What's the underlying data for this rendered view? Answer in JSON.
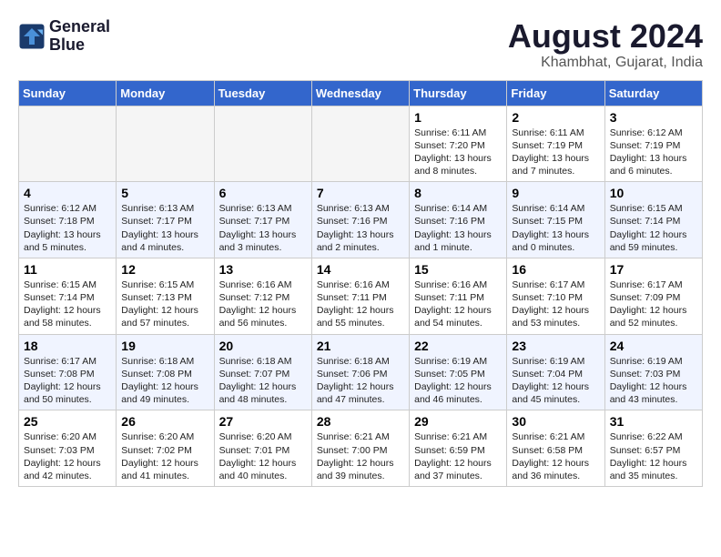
{
  "header": {
    "logo_line1": "General",
    "logo_line2": "Blue",
    "title": "August 2024",
    "subtitle": "Khambhat, Gujarat, India"
  },
  "columns": [
    "Sunday",
    "Monday",
    "Tuesday",
    "Wednesday",
    "Thursday",
    "Friday",
    "Saturday"
  ],
  "weeks": [
    {
      "days": [
        {
          "num": "",
          "empty": true
        },
        {
          "num": "",
          "empty": true
        },
        {
          "num": "",
          "empty": true
        },
        {
          "num": "",
          "empty": true
        },
        {
          "num": "1",
          "info": "Sunrise: 6:11 AM\nSunset: 7:20 PM\nDaylight: 13 hours\nand 8 minutes."
        },
        {
          "num": "2",
          "info": "Sunrise: 6:11 AM\nSunset: 7:19 PM\nDaylight: 13 hours\nand 7 minutes."
        },
        {
          "num": "3",
          "info": "Sunrise: 6:12 AM\nSunset: 7:19 PM\nDaylight: 13 hours\nand 6 minutes."
        }
      ]
    },
    {
      "days": [
        {
          "num": "4",
          "info": "Sunrise: 6:12 AM\nSunset: 7:18 PM\nDaylight: 13 hours\nand 5 minutes."
        },
        {
          "num": "5",
          "info": "Sunrise: 6:13 AM\nSunset: 7:17 PM\nDaylight: 13 hours\nand 4 minutes."
        },
        {
          "num": "6",
          "info": "Sunrise: 6:13 AM\nSunset: 7:17 PM\nDaylight: 13 hours\nand 3 minutes."
        },
        {
          "num": "7",
          "info": "Sunrise: 6:13 AM\nSunset: 7:16 PM\nDaylight: 13 hours\nand 2 minutes."
        },
        {
          "num": "8",
          "info": "Sunrise: 6:14 AM\nSunset: 7:16 PM\nDaylight: 13 hours\nand 1 minute."
        },
        {
          "num": "9",
          "info": "Sunrise: 6:14 AM\nSunset: 7:15 PM\nDaylight: 13 hours\nand 0 minutes."
        },
        {
          "num": "10",
          "info": "Sunrise: 6:15 AM\nSunset: 7:14 PM\nDaylight: 12 hours\nand 59 minutes."
        }
      ]
    },
    {
      "days": [
        {
          "num": "11",
          "info": "Sunrise: 6:15 AM\nSunset: 7:14 PM\nDaylight: 12 hours\nand 58 minutes."
        },
        {
          "num": "12",
          "info": "Sunrise: 6:15 AM\nSunset: 7:13 PM\nDaylight: 12 hours\nand 57 minutes."
        },
        {
          "num": "13",
          "info": "Sunrise: 6:16 AM\nSunset: 7:12 PM\nDaylight: 12 hours\nand 56 minutes."
        },
        {
          "num": "14",
          "info": "Sunrise: 6:16 AM\nSunset: 7:11 PM\nDaylight: 12 hours\nand 55 minutes."
        },
        {
          "num": "15",
          "info": "Sunrise: 6:16 AM\nSunset: 7:11 PM\nDaylight: 12 hours\nand 54 minutes."
        },
        {
          "num": "16",
          "info": "Sunrise: 6:17 AM\nSunset: 7:10 PM\nDaylight: 12 hours\nand 53 minutes."
        },
        {
          "num": "17",
          "info": "Sunrise: 6:17 AM\nSunset: 7:09 PM\nDaylight: 12 hours\nand 52 minutes."
        }
      ]
    },
    {
      "days": [
        {
          "num": "18",
          "info": "Sunrise: 6:17 AM\nSunset: 7:08 PM\nDaylight: 12 hours\nand 50 minutes."
        },
        {
          "num": "19",
          "info": "Sunrise: 6:18 AM\nSunset: 7:08 PM\nDaylight: 12 hours\nand 49 minutes."
        },
        {
          "num": "20",
          "info": "Sunrise: 6:18 AM\nSunset: 7:07 PM\nDaylight: 12 hours\nand 48 minutes."
        },
        {
          "num": "21",
          "info": "Sunrise: 6:18 AM\nSunset: 7:06 PM\nDaylight: 12 hours\nand 47 minutes."
        },
        {
          "num": "22",
          "info": "Sunrise: 6:19 AM\nSunset: 7:05 PM\nDaylight: 12 hours\nand 46 minutes."
        },
        {
          "num": "23",
          "info": "Sunrise: 6:19 AM\nSunset: 7:04 PM\nDaylight: 12 hours\nand 45 minutes."
        },
        {
          "num": "24",
          "info": "Sunrise: 6:19 AM\nSunset: 7:03 PM\nDaylight: 12 hours\nand 43 minutes."
        }
      ]
    },
    {
      "days": [
        {
          "num": "25",
          "info": "Sunrise: 6:20 AM\nSunset: 7:03 PM\nDaylight: 12 hours\nand 42 minutes."
        },
        {
          "num": "26",
          "info": "Sunrise: 6:20 AM\nSunset: 7:02 PM\nDaylight: 12 hours\nand 41 minutes."
        },
        {
          "num": "27",
          "info": "Sunrise: 6:20 AM\nSunset: 7:01 PM\nDaylight: 12 hours\nand 40 minutes."
        },
        {
          "num": "28",
          "info": "Sunrise: 6:21 AM\nSunset: 7:00 PM\nDaylight: 12 hours\nand 39 minutes."
        },
        {
          "num": "29",
          "info": "Sunrise: 6:21 AM\nSunset: 6:59 PM\nDaylight: 12 hours\nand 37 minutes."
        },
        {
          "num": "30",
          "info": "Sunrise: 6:21 AM\nSunset: 6:58 PM\nDaylight: 12 hours\nand 36 minutes."
        },
        {
          "num": "31",
          "info": "Sunrise: 6:22 AM\nSunset: 6:57 PM\nDaylight: 12 hours\nand 35 minutes."
        }
      ]
    }
  ]
}
